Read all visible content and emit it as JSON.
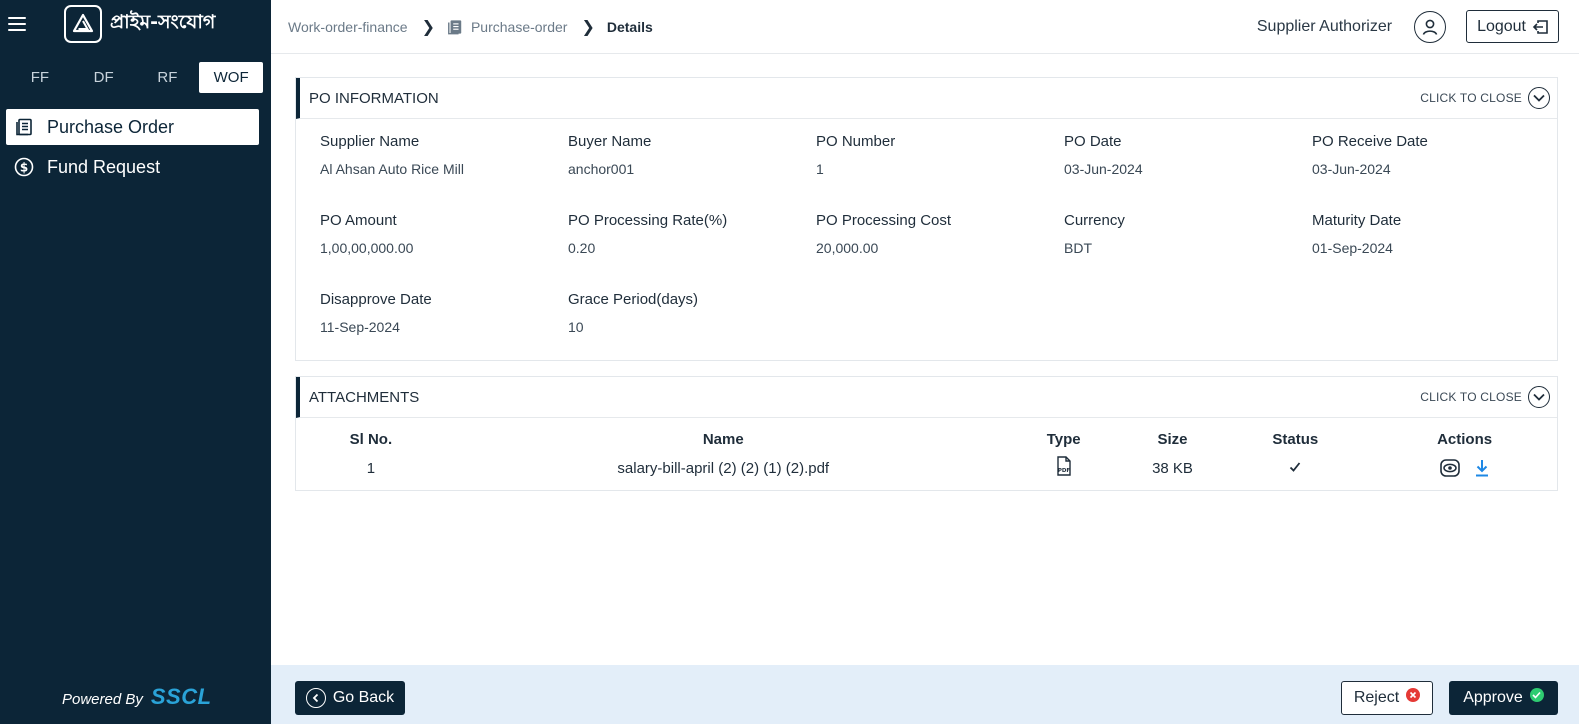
{
  "app": {
    "logo_text": "প্রাইম-সংযোগ",
    "powered_by": "Powered By",
    "brand": "SSCL"
  },
  "sidebar": {
    "tabs": [
      {
        "label": "FF",
        "active": false
      },
      {
        "label": "DF",
        "active": false
      },
      {
        "label": "RF",
        "active": false
      },
      {
        "label": "WOF",
        "active": true
      }
    ],
    "items": [
      {
        "label": "Purchase Order",
        "icon": "list-document-icon",
        "active": true
      },
      {
        "label": "Fund Request",
        "icon": "dollar-circle-icon",
        "active": false
      }
    ]
  },
  "header": {
    "breadcrumb": [
      "Work-order-finance",
      "Purchase-order",
      "Details"
    ],
    "role": "Supplier Authorizer",
    "logout_label": "Logout"
  },
  "po_panel": {
    "title": "PO INFORMATION",
    "toggle_label": "CLICK TO CLOSE",
    "fields": [
      {
        "label": "Supplier Name",
        "value": "Al Ahsan Auto Rice Mill"
      },
      {
        "label": "Buyer Name",
        "value": "anchor001"
      },
      {
        "label": "PO Number",
        "value": "1"
      },
      {
        "label": "PO Date",
        "value": "03-Jun-2024"
      },
      {
        "label": "PO Receive Date",
        "value": "03-Jun-2024"
      },
      {
        "label": "PO Amount",
        "value": "1,00,00,000.00"
      },
      {
        "label": "PO Processing Rate(%)",
        "value": "0.20"
      },
      {
        "label": "PO Processing Cost",
        "value": "20,000.00"
      },
      {
        "label": "Currency",
        "value": "BDT"
      },
      {
        "label": "Maturity Date",
        "value": "01-Sep-2024"
      },
      {
        "label": "Disapprove Date",
        "value": "11-Sep-2024"
      },
      {
        "label": "Grace Period(days)",
        "value": "10"
      }
    ]
  },
  "attachments_panel": {
    "title": "ATTACHMENTS",
    "toggle_label": "CLICK TO CLOSE",
    "columns": [
      "Sl No.",
      "Name",
      "Type",
      "Size",
      "Status",
      "Actions"
    ],
    "rows": [
      {
        "sl": "1",
        "name": "salary-bill-april (2) (2) (1) (2).pdf",
        "type_icon": "pdf-file-icon",
        "size": "38 KB",
        "status_icon": "checkmark-icon",
        "actions": [
          "eye-icon",
          "download-icon"
        ]
      }
    ]
  },
  "footer": {
    "back_label": "Go Back",
    "reject_label": "Reject",
    "approve_label": "Approve"
  },
  "colors": {
    "sidebar_bg": "#0c2537",
    "accent": "#2aa3d8",
    "footer_bg": "#e3eef9",
    "reject_badge": "#e53935",
    "approve_badge": "#2ecc71"
  }
}
